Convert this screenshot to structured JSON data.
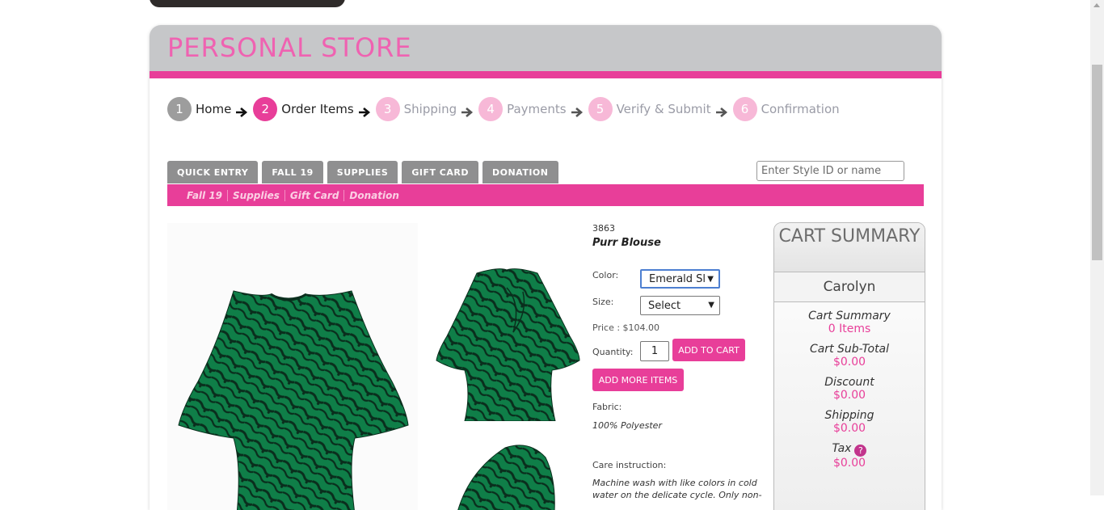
{
  "store": {
    "title": "PERSONAL STORE"
  },
  "steps": [
    {
      "num": "1",
      "label": "Home"
    },
    {
      "num": "2",
      "label": "Order Items"
    },
    {
      "num": "3",
      "label": "Shipping"
    },
    {
      "num": "4",
      "label": "Payments"
    },
    {
      "num": "5",
      "label": "Verify & Submit"
    },
    {
      "num": "6",
      "label": "Confirmation"
    }
  ],
  "tabs": [
    "QUICK ENTRY",
    "FALL 19",
    "SUPPLIES",
    "GIFT CARD",
    "DONATION"
  ],
  "search": {
    "placeholder": "Enter Style ID or name"
  },
  "subnav": [
    "Fall 19",
    "Supplies",
    "Gift Card",
    "Donation"
  ],
  "product": {
    "style_id": "3863",
    "name": "Purr Blouse",
    "color_label": "Color:",
    "color_value": "Emerald Sl",
    "size_label": "Size:",
    "size_value": "Select",
    "price": "Price : $104.00",
    "quantity_label": "Quantity:",
    "quantity_value": "1",
    "add_to_cart": "ADD TO CART",
    "add_more": "ADD MORE ITEMS",
    "fabric_label": "Fabric:",
    "fabric_value": "100% Polyester",
    "care_label": "Care instruction:",
    "care_value_line1": "Machine wash with like colors in cold",
    "care_value_line2": "water on the delicate cycle. Only non-"
  },
  "cart": {
    "title": "CART SUMMARY",
    "customer": "Carolyn",
    "summary_label": "Cart Summary",
    "items": "0 Items",
    "subtotal_label": "Cart Sub-Total",
    "subtotal": "$0.00",
    "discount_label": "Discount",
    "discount": "$0.00",
    "shipping_label": "Shipping",
    "shipping": "$0.00",
    "tax_label": "Tax",
    "tax": "$0.00"
  },
  "colors": {
    "accent": "#e83e99",
    "title": "#ef62b1",
    "header_bg": "#c6c7c9",
    "blouse": "#0f7e48"
  },
  "icons": {
    "arrow": "arrow-right-icon",
    "help": "question-mark-icon"
  }
}
